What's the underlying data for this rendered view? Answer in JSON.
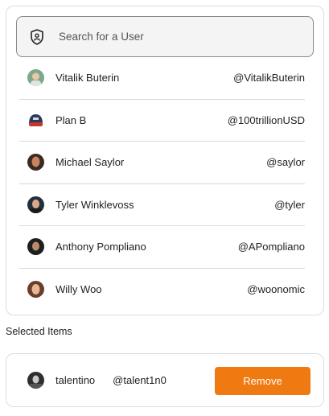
{
  "search": {
    "placeholder": "Search for a User",
    "icon": "shield-user-icon"
  },
  "users": [
    {
      "name": "Vitalik Buterin",
      "handle": "@VitalikButerin",
      "avatar_color": "#7fa88a"
    },
    {
      "name": "Plan B",
      "handle": "@100trillionUSD",
      "avatar_color": "#2b3a5a"
    },
    {
      "name": "Michael Saylor",
      "handle": "@saylor",
      "avatar_color": "#8a4a32"
    },
    {
      "name": "Tyler Winklevoss",
      "handle": "@tyler",
      "avatar_color": "#23303c"
    },
    {
      "name": "Anthony Pompliano",
      "handle": "@APompliano",
      "avatar_color": "#1e1e1e"
    },
    {
      "name": "Willy Woo",
      "handle": "@woonomic",
      "avatar_color": "#6b3e2a"
    }
  ],
  "selected": {
    "title": "Selected Items",
    "item": {
      "name": "talentino",
      "handle": "@talent1n0",
      "avatar_color": "#2e2e2e"
    },
    "remove_label": "Remove"
  },
  "colors": {
    "accent": "#f07a12",
    "border": "#dcdcdc",
    "search_border": "#8a8a8a",
    "search_bg": "#f4f4f4"
  }
}
